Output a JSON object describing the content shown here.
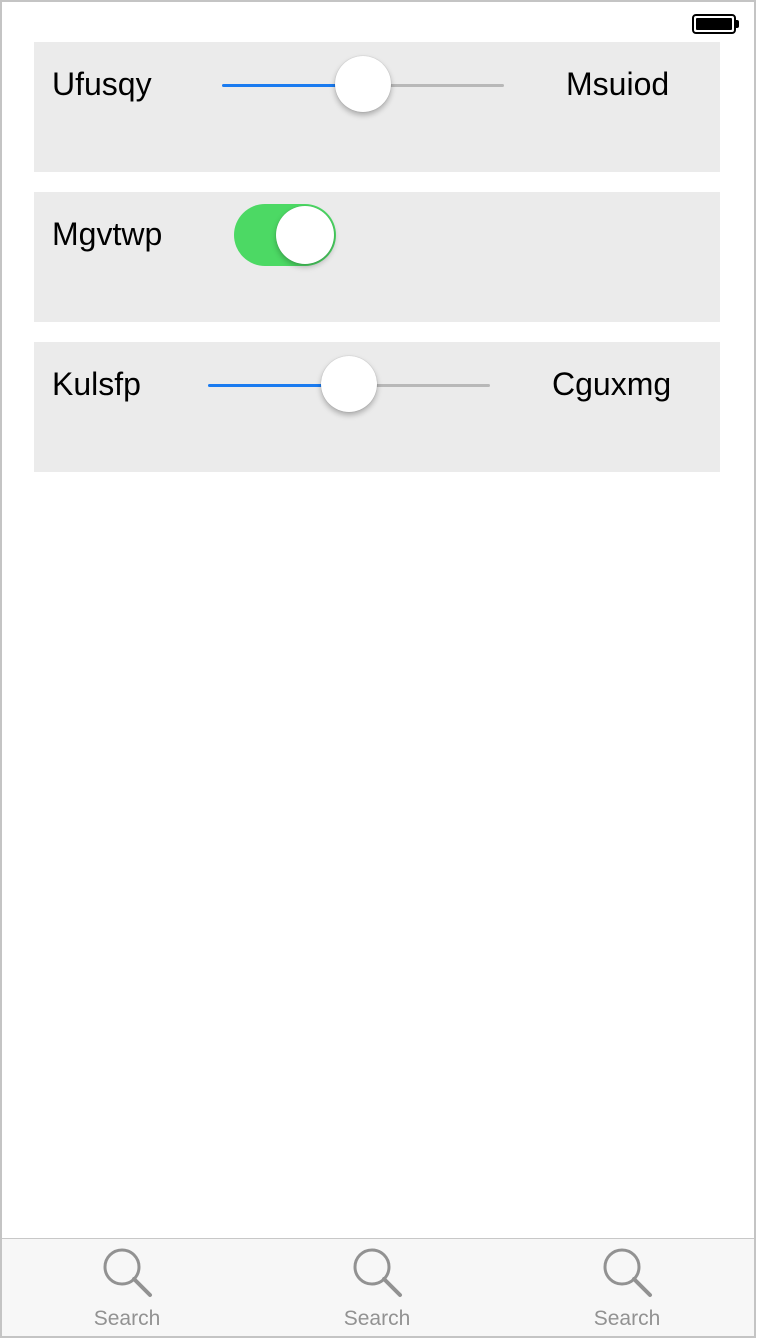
{
  "status_bar": {
    "battery_icon": "battery-full-icon"
  },
  "rows": [
    {
      "type": "slider",
      "label": "Ufusqy",
      "right_label": "Msuiod",
      "value": 0.5
    },
    {
      "type": "switch",
      "label": "Mgvtwp",
      "on": true,
      "on_color": "#4cd964"
    },
    {
      "type": "slider",
      "label": "Kulsfp",
      "right_label": "Cguxmg",
      "value": 0.5
    }
  ],
  "tabbar": {
    "tabs": [
      {
        "label": "Search",
        "icon": "search-icon"
      },
      {
        "label": "Search",
        "icon": "search-icon"
      },
      {
        "label": "Search",
        "icon": "search-icon"
      }
    ]
  },
  "colors": {
    "accent": "#1a7bf0",
    "track_inactive": "#b8b8b8",
    "row_background": "#ebebeb",
    "tab_label": "#929292"
  }
}
